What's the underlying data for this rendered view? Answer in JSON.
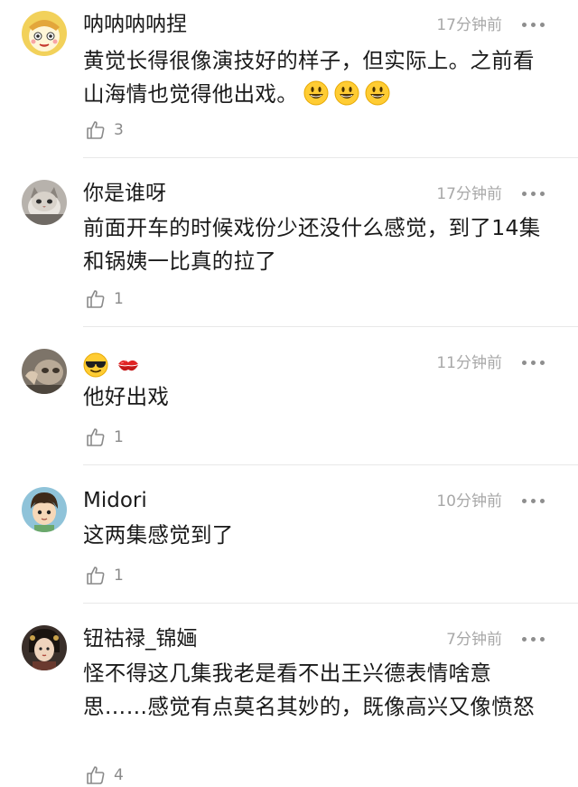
{
  "comments": [
    {
      "username": "呐呐呐呐捏",
      "time": "17分钟前",
      "text": "黄觉长得很像演技好的样子，但实际上。之前看山海情也觉得他出戏。",
      "emojis": [
        "grinning-face",
        "grinning-face",
        "grinning-face"
      ],
      "likes": "3",
      "avatar": "cartoon-avatar"
    },
    {
      "username": "你是谁呀",
      "time": "17分钟前",
      "text": "前面开车的时候戏份少还没什么感觉，到了14集和锅姨一比真的拉了",
      "likes": "1",
      "avatar": "cat-avatar"
    },
    {
      "username": "",
      "username_emojis": [
        "sunglasses-face",
        "kiss-mark"
      ],
      "time": "11分钟前",
      "text": "他好出戏",
      "likes": "1",
      "avatar": "cat-photo-avatar"
    },
    {
      "username": "Midori",
      "time": "10分钟前",
      "text": "这两集感觉到了",
      "likes": "1",
      "avatar": "anime-boy-avatar"
    },
    {
      "username": "钮祜禄_锦婳",
      "time": "7分钟前",
      "text": "怪不得这几集我老是看不出王兴德表情啥意思……感觉有点莫名其妙的，既像高兴又像愤怒",
      "likes": "4",
      "avatar": "portrait-avatar"
    }
  ],
  "colors": {
    "text": "#1a1a1a",
    "meta": "#a8a8a8",
    "divider": "#e8e8e8",
    "emoji_yellow": "#ffcc33"
  }
}
